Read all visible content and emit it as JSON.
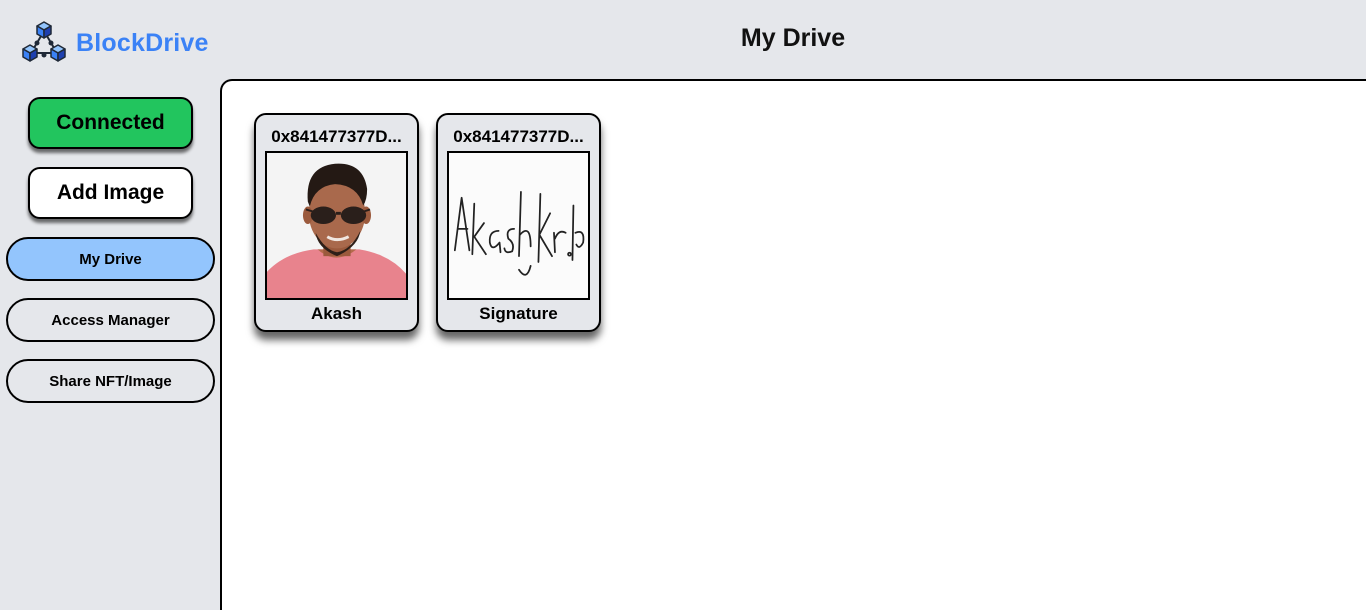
{
  "brand": {
    "name": "BlockDrive",
    "logo_icon": "blockchain-cubes-icon",
    "color": "#3b82f6"
  },
  "header": {
    "title": "My Drive"
  },
  "sidebar": {
    "connect_label": "Connected",
    "connect_color": "#22c55e",
    "add_image_label": "Add Image",
    "nav": [
      {
        "label": "My Drive",
        "active": true
      },
      {
        "label": "Access Manager",
        "active": false
      },
      {
        "label": "Share NFT/Image",
        "active": false
      }
    ],
    "active_color": "#93c5fd"
  },
  "drive": {
    "files": [
      {
        "id": "0x841477377D...",
        "name": "Akash",
        "thumbnail": "portrait-photo"
      },
      {
        "id": "0x841477377D...",
        "name": "Signature",
        "thumbnail": "handwritten-signature"
      }
    ]
  }
}
